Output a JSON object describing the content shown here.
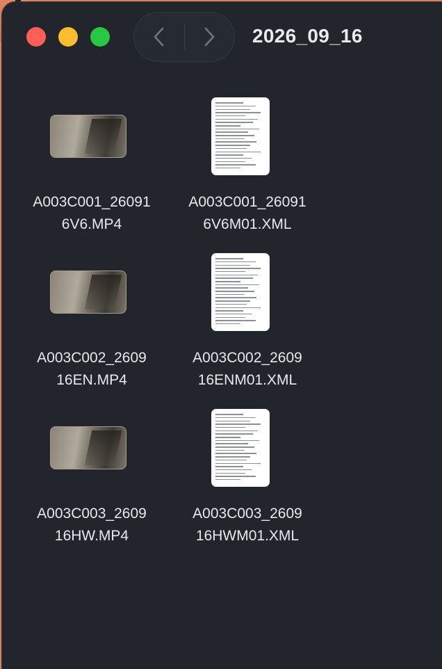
{
  "window": {
    "title": "2026_09_16"
  },
  "toolbar": {
    "back_icon": "chevron-left-icon",
    "forward_icon": "chevron-right-icon"
  },
  "files": [
    {
      "type": "video",
      "line1": "A003C001_26091",
      "line2": "6V6.MP4"
    },
    {
      "type": "xml",
      "line1": "A003C001_26091",
      "line2": "6V6M01.XML"
    },
    {
      "type": "video",
      "line1": "A003C002_2609",
      "line2": "16EN.MP4"
    },
    {
      "type": "xml",
      "line1": "A003C002_2609",
      "line2": "16ENM01.XML"
    },
    {
      "type": "video",
      "line1": "A003C003_2609",
      "line2": "16HW.MP4"
    },
    {
      "type": "xml",
      "line1": "A003C003_2609",
      "line2": "16HWM01.XML"
    }
  ],
  "colors": {
    "window_bg": "#22262c",
    "close": "#fe5f57",
    "minimize": "#febc2e",
    "zoom": "#28c840"
  }
}
